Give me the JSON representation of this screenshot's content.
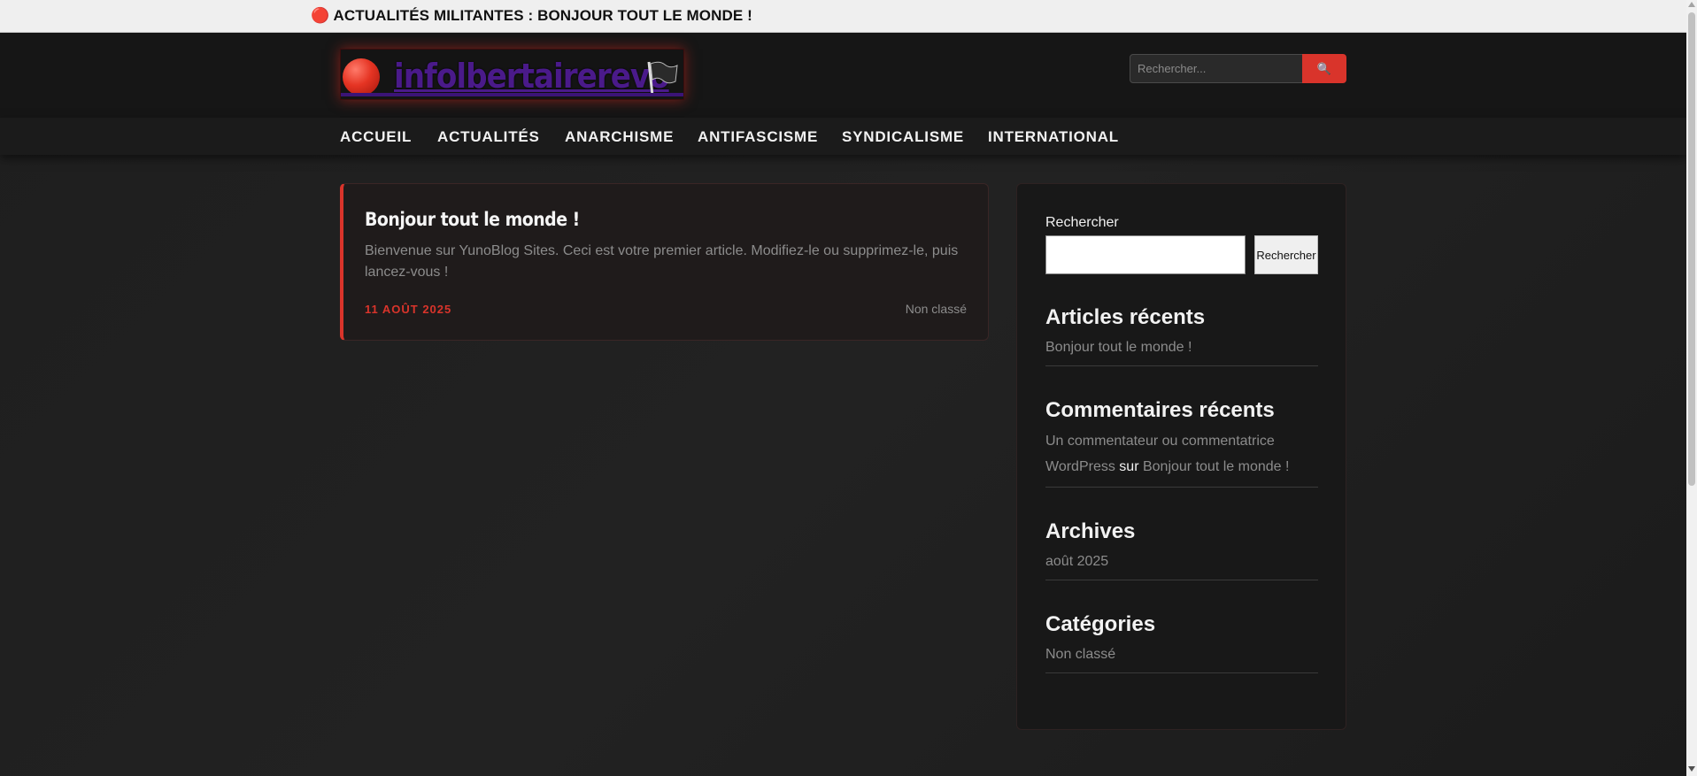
{
  "ticker": {
    "icon": "red-circle-icon",
    "text": "🔴 ACTUALITÉS MILITANTES : BONJOUR TOUT LE MONDE !"
  },
  "header": {
    "logo_text": "infolbertairerevo",
    "logo_icons": [
      "red-circle-icon",
      "black-flag-icon"
    ],
    "search": {
      "placeholder": "Rechercher...",
      "button_icon": "search-icon",
      "button_label": "🔍"
    }
  },
  "nav": {
    "items": [
      "ACCUEIL",
      "ACTUALITÉS",
      "ANARCHISME",
      "ANTIFASCISME",
      "SYNDICALISME",
      "INTERNATIONAL"
    ]
  },
  "article": {
    "title": "Bonjour tout le monde !",
    "excerpt": "Bienvenue sur YunoBlog Sites. Ceci est votre premier article. Modifiez-le ou supprimez-le, puis lancez-vous !",
    "date": "11 AOÛT 2025",
    "category": "Non classé"
  },
  "sidebar": {
    "search_label": "Rechercher",
    "search_button": "Rechercher",
    "recent_posts_title": "Articles récents",
    "recent_posts": [
      "Bonjour tout le monde !"
    ],
    "recent_comments_title": "Commentaires récents",
    "recent_comment": {
      "author": "Un commentateur ou commentatrice WordPress",
      "on": "sur",
      "post": "Bonjour tout le monde !"
    },
    "archives_title": "Archives",
    "archives": [
      "août 2025"
    ],
    "categories_title": "Catégories",
    "categories": [
      "Non classé"
    ]
  },
  "colors": {
    "accent": "#d9342b",
    "logo_text": "#4a1a8a",
    "background": "#1e1e1e"
  }
}
